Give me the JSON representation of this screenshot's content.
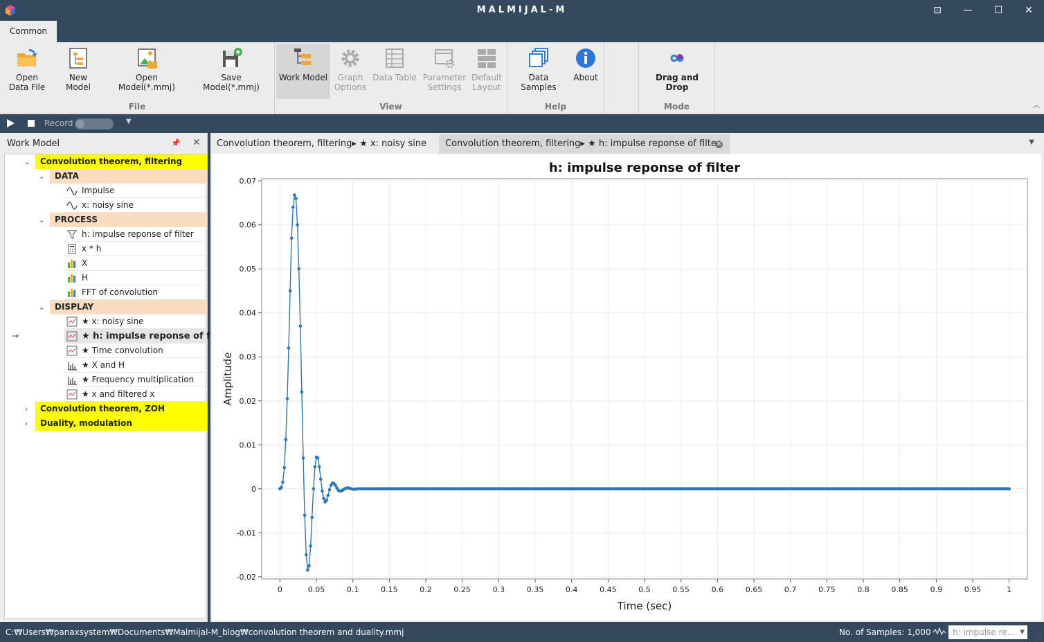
{
  "window": {
    "title": "MALMIJAL-M",
    "buttons": [
      "⊡",
      "—",
      "☐",
      "✕"
    ]
  },
  "ribbon": {
    "tab": "Common",
    "groups": {
      "file": {
        "label": "File",
        "open_data_file": "Open Data File",
        "new_model": "New Model",
        "open_model": "Open Model(*.mmj)",
        "save_model": "Save Model(*.mmj)"
      },
      "view": {
        "label": "View",
        "work_model": "Work Model",
        "graph_options": "Graph Options",
        "data_table": "Data Table",
        "parameter_settings": "Parameter Settings",
        "default_layout": "Default Layout"
      },
      "help": {
        "label": "Help",
        "data_samples": "Data Samples",
        "about": "About"
      },
      "mode": {
        "label": "Mode",
        "drag_and_drop": "Drag and Drop"
      }
    },
    "collapse": "︿"
  },
  "recordbar": {
    "record_label": "Record"
  },
  "work_model": {
    "title": "Work Model",
    "models": [
      {
        "name": "Convolution theorem, filtering",
        "sections": [
          {
            "name": "DATA",
            "items": [
              "Impulse",
              "x: noisy sine"
            ]
          },
          {
            "name": "PROCESS",
            "items": [
              "h: impulse reponse of filter",
              "x * h",
              "X",
              "H",
              "FFT of convolution"
            ]
          },
          {
            "name": "DISPLAY",
            "items": [
              "★ x: noisy sine",
              "★ h: impulse reponse of filter",
              "★ Time convolution",
              "★ X and H",
              "★ Frequency multiplication",
              "★ x and filtered x"
            ]
          }
        ]
      },
      {
        "name": "Convolution theorem, ZOH"
      },
      {
        "name": "Duality, modulation"
      }
    ],
    "current_arrow": "→"
  },
  "doc_tabs": [
    {
      "label": "Convolution theorem, filtering▸ ★ x: noisy sine"
    },
    {
      "label": "Convolution theorem, filtering▸ ★ h: impulse reponse of filter",
      "close": "×"
    }
  ],
  "chart_data": {
    "type": "scatter",
    "title": "h: impulse reponse of filter",
    "xlabel": "Time (sec)",
    "ylabel": "Amplitude",
    "xlim": [
      -0.025,
      1.025
    ],
    "ylim": [
      -0.0205,
      0.0705
    ],
    "xticks": [
      "0",
      "0.05",
      "0.1",
      "0.15",
      "0.2",
      "0.25",
      "0.3",
      "0.35",
      "0.4",
      "0.45",
      "0.5",
      "0.55",
      "0.6",
      "0.65",
      "0.7",
      "0.75",
      "0.8",
      "0.85",
      "0.9",
      "0.95",
      "1"
    ],
    "yticks": [
      "-0.02",
      "-0.01",
      "0",
      "0.01",
      "0.02",
      "0.03",
      "0.04",
      "0.05",
      "0.06",
      "0.07"
    ],
    "grid": true,
    "color": "#2e75b6",
    "samples": 1000,
    "x": [
      0,
      0.002,
      0.004,
      0.006,
      0.008,
      0.01,
      0.012,
      0.014,
      0.016,
      0.018,
      0.02,
      0.022,
      0.024,
      0.026,
      0.028,
      0.03,
      0.032,
      0.034,
      0.036,
      0.038,
      0.04,
      0.042,
      0.044,
      0.046,
      0.048,
      0.05,
      0.052,
      0.054,
      0.056,
      0.058,
      0.06,
      0.062,
      0.064,
      0.066,
      0.068,
      0.07,
      0.072,
      0.074,
      0.076,
      0.078,
      0.08,
      0.082,
      0.084,
      0.086,
      0.088,
      0.09,
      0.092,
      0.094,
      0.096,
      0.098,
      0.1,
      0.102,
      0.104,
      0.106,
      0.108,
      0.11,
      0.112,
      0.114,
      0.116,
      0.118,
      0.12,
      0.122,
      0.124,
      0.126,
      0.128,
      0.13,
      0.132,
      0.134,
      0.136,
      0.138,
      0.14,
      0.145,
      0.15,
      0.16,
      0.17,
      0.18,
      0.2,
      0.25,
      0.3,
      0.35,
      0.4,
      0.45,
      0.5,
      0.55,
      0.6,
      0.65,
      0.7,
      0.75,
      0.8,
      0.85,
      0.9,
      0.95,
      1.0
    ],
    "y": [
      0,
      0.0003,
      0.0015,
      0.0048,
      0.0112,
      0.0205,
      0.032,
      0.045,
      0.057,
      0.064,
      0.0668,
      0.066,
      0.06,
      0.05,
      0.037,
      0.022,
      0.007,
      -0.006,
      -0.015,
      -0.0185,
      -0.0175,
      -0.013,
      -0.0065,
      0,
      0.005,
      0.0072,
      0.007,
      0.005,
      0.0022,
      -0.0005,
      -0.0022,
      -0.003,
      -0.0026,
      -0.0015,
      -0.0002,
      0.0008,
      0.0013,
      0.0012,
      0.0008,
      0.0002,
      -0.0003,
      -0.0005,
      -0.0005,
      -0.0003,
      -0.0001,
      0.0001,
      0.0002,
      0.0002,
      0.0001,
      0.0,
      -0.0001,
      -0.0001,
      -0.0001,
      0,
      0,
      0,
      0,
      0,
      0,
      0,
      0,
      0,
      0,
      0,
      0,
      0,
      0,
      0,
      0,
      0,
      0,
      0,
      0,
      0,
      0,
      0,
      0,
      0,
      0,
      0,
      0,
      0,
      0,
      0,
      0,
      0,
      0,
      0,
      0,
      0,
      0,
      0,
      0
    ]
  },
  "statusbar": {
    "path": "C:₩Users₩panaxsystem₩Documents₩Malmijal-M_blog₩convolution theorem and duality.mmj",
    "samples_label": "No. of Samples: 1,000",
    "combo_value": "h: impulse re..."
  }
}
